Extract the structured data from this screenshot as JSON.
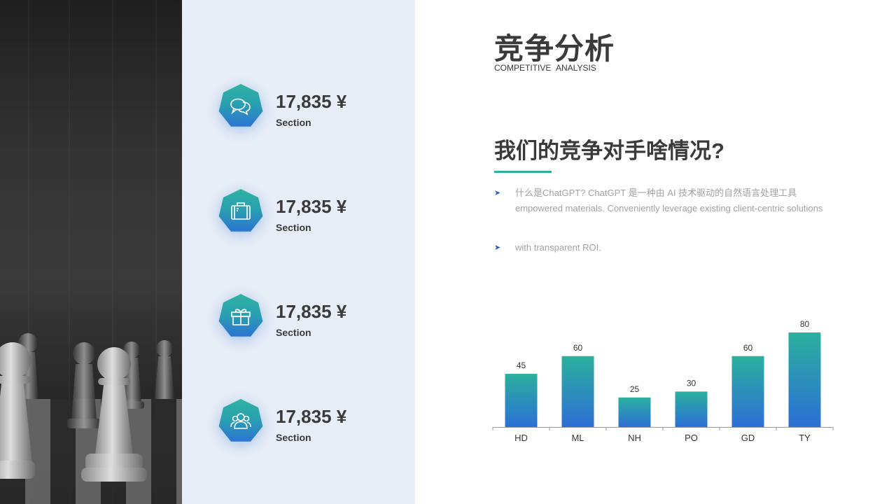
{
  "title": {
    "cn": "竞争分析",
    "en": "COMPETITIVE  ANALYSIS"
  },
  "heading": "我们的竞争对手啥情况?",
  "bullets": [
    "什么是ChatGPT? ChatGPT 是一种由 AI 技术驱动的自然语言处理工具 empowered materials. Conveniently leverage existing client-centric solutions",
    "with transparent ROI."
  ],
  "stats": [
    {
      "value": "17,835 ¥",
      "label": "Section",
      "icon": "chat-bubbles-icon"
    },
    {
      "value": "17,835 ¥",
      "label": "Section",
      "icon": "briefcase-icon"
    },
    {
      "value": "17,835 ¥",
      "label": "Section",
      "icon": "gift-icon"
    },
    {
      "value": "17,835 ¥",
      "label": "Section",
      "icon": "users-icon"
    }
  ],
  "colors": {
    "accent_teal": "#2bb09e",
    "accent_blue": "#2d6fd6",
    "text_dark": "#3a3a3a",
    "text_muted": "#a2a2a2",
    "panel_bg": "#e8eef7"
  },
  "chart_data": {
    "type": "bar",
    "categories": [
      "HD",
      "ML",
      "NH",
      "PO",
      "GD",
      "TY"
    ],
    "values": [
      45,
      60,
      25,
      30,
      60,
      80
    ],
    "ylim": [
      0,
      80
    ],
    "grid": false,
    "data_labels": true
  }
}
